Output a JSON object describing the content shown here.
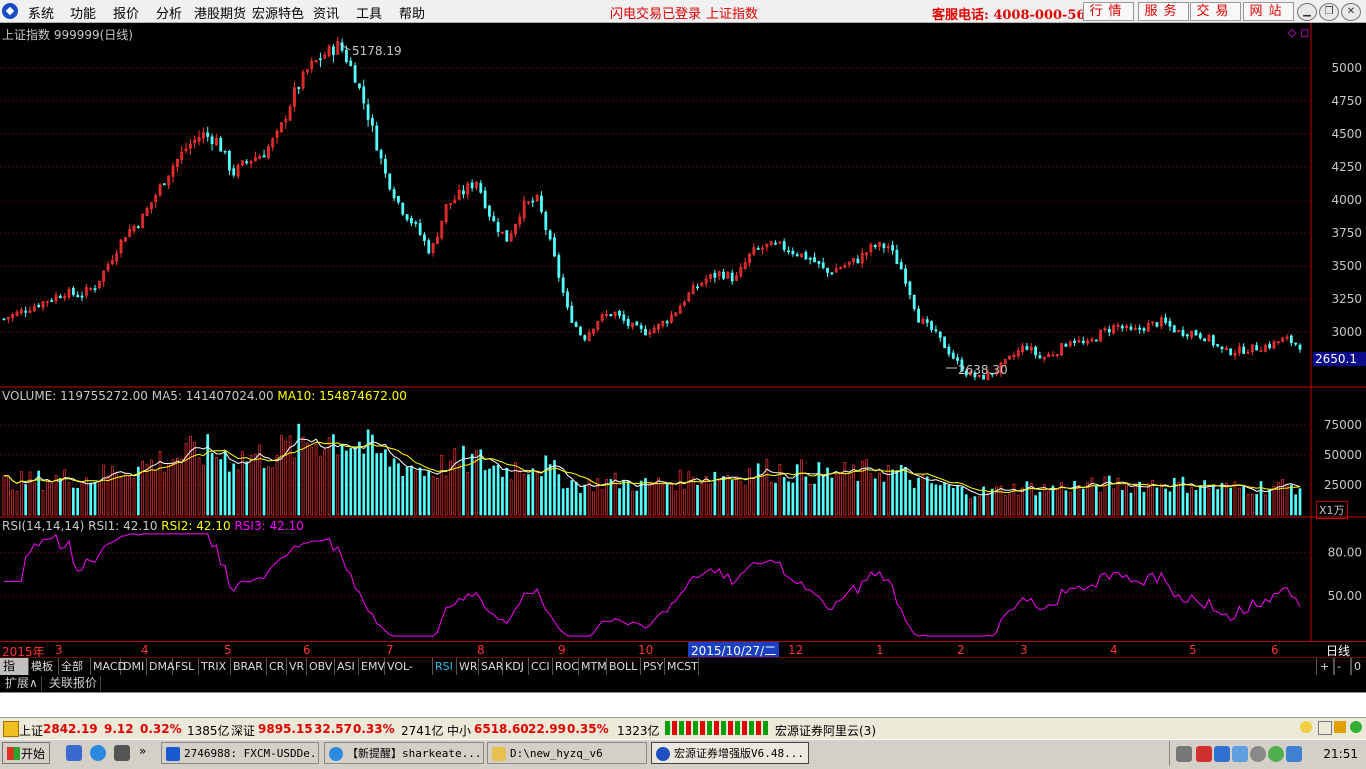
{
  "menu": [
    "系统",
    "功能",
    "报价",
    "分析",
    "港股期货",
    "宏源特色",
    "资讯",
    "工具",
    "帮助"
  ],
  "status_center": [
    "闪电交易已登录",
    "上证指数"
  ],
  "hotline": "客服电话: 4008-000-562",
  "top_buttons": [
    "行情",
    "服务",
    "交易",
    "网站"
  ],
  "window_controls": [
    "minimize-icon",
    "restore-icon",
    "close-icon"
  ],
  "chart_title": "上证指数 999999(日线)",
  "price_annotations": {
    "high": "5178.19",
    "low": "2638.30"
  },
  "price_axis_ticks": [
    "5000",
    "4750",
    "4500",
    "4250",
    "4000",
    "3750",
    "3500",
    "3250",
    "3000"
  ],
  "current_price_label": "2650.1",
  "volume_header": {
    "label": "VOLUME: 119755272.00",
    "ma5": "MA5: 141407024.00",
    "ma10": "MA10: 154874672.00"
  },
  "volume_axis_ticks": [
    "75000",
    "50000",
    "25000"
  ],
  "volume_unit": "X1万",
  "rsi_header": {
    "label": "RSI(14,14,14)",
    "rsi1": "RSI1: 42.10",
    "rsi2": "RSI2: 42.10",
    "rsi3": "RSI3: 42.10"
  },
  "rsi_axis_ticks": [
    "80.00",
    "50.00"
  ],
  "date_axis": {
    "labels": [
      "2015年",
      "3",
      "4",
      "5",
      "6",
      "7",
      "8",
      "9",
      "10",
      "12",
      "1",
      "2",
      "3",
      "4",
      "5",
      "6"
    ],
    "cursor_date": "2015/10/27/二",
    "period_label": "日线"
  },
  "indicator_tabs": [
    "指标",
    "模板",
    "全部",
    "MACD",
    "DMI",
    "DMA",
    "FSL",
    "TRIX",
    "BRAR",
    "CR",
    "VR",
    "OBV",
    "ASI",
    "EMV",
    "VOL-TDX",
    "RSI",
    "WR",
    "SAR",
    "KDJ",
    "CCI",
    "ROC",
    "MTM",
    "BOLL",
    "PSY",
    "MCST"
  ],
  "active_tab": "RSI",
  "zoom_controls": [
    "+",
    "-",
    "0"
  ],
  "ext_buttons": [
    "扩展∧",
    "关联报价"
  ],
  "statusbar": {
    "sh": {
      "name": "上证",
      "price": "2842.19",
      "change": "9.12",
      "pct": "0.32%",
      "vol": "1385亿"
    },
    "sz": {
      "name": "深证",
      "price": "9895.15",
      "change": "32.57",
      "pct": "0.33%",
      "vol": "2741亿"
    },
    "zx": {
      "name": "中小",
      "price": "6518.60",
      "change": "22.99",
      "pct": "0.35%",
      "vol": "1323亿"
    },
    "broker": "宏源证券阿里云(3)"
  },
  "taskbar": {
    "start": "开始",
    "items": [
      "2746988: FXCM-USDDe...",
      "【新提醒】sharkeate...",
      "D:\\new_hyzq_v6",
      "宏源证券增强版V6.48..."
    ],
    "clock": "21:51"
  },
  "colors": {
    "up": "#ff3232",
    "down": "#54ffff",
    "ma5": "#ffffff",
    "ma10": "#ffff00",
    "rsi": "#ff00ff",
    "grid": "#8b0000",
    "axis": "#c80000"
  },
  "chart_data": {
    "type": "candlestick",
    "ylim": [
      2600,
      5250
    ],
    "month_ticks": [
      "2015年",
      "3",
      "4",
      "5",
      "6",
      "7",
      "8",
      "9",
      "10",
      "12",
      "1",
      "2",
      "3",
      "4",
      "5",
      "6"
    ],
    "close_series": [
      3100,
      3150,
      3200,
      3250,
      3300,
      3280,
      3350,
      3550,
      3750,
      3850,
      4050,
      4250,
      4400,
      4500,
      4450,
      4200,
      4300,
      4350,
      4500,
      4800,
      5000,
      5100,
      5178,
      4950,
      4600,
      4200,
      3950,
      3800,
      3600,
      3950,
      4050,
      4150,
      3850,
      3700,
      3950,
      4000,
      3600,
      3150,
      2950,
      3100,
      3150,
      3050,
      3000,
      3050,
      3150,
      3300,
      3400,
      3450,
      3400,
      3600,
      3650,
      3650,
      3600,
      3550,
      3450,
      3500,
      3550,
      3650,
      3650,
      3450,
      3100,
      3000,
      2850,
      2700,
      2650,
      2700,
      2800,
      2900,
      2800,
      2850,
      2950,
      2900,
      3000,
      3050,
      3000,
      3050,
      3080,
      3000,
      3000,
      2950,
      2850,
      2860,
      2880,
      2900,
      2950,
      2900
    ],
    "ohlc_sample": [
      {
        "t": "high",
        "v": 5178.19
      },
      {
        "t": "low",
        "v": 2638.3
      },
      {
        "t": "last",
        "v": 2650.1
      }
    ],
    "volume": {
      "ylim": [
        0,
        95000
      ],
      "ma5": 141407024.0,
      "ma10": 154874672.0,
      "last": 119755272.0
    },
    "rsi": {
      "ylim": [
        20,
        95
      ],
      "gridlines": [
        80,
        50
      ],
      "last": 42.1
    }
  }
}
